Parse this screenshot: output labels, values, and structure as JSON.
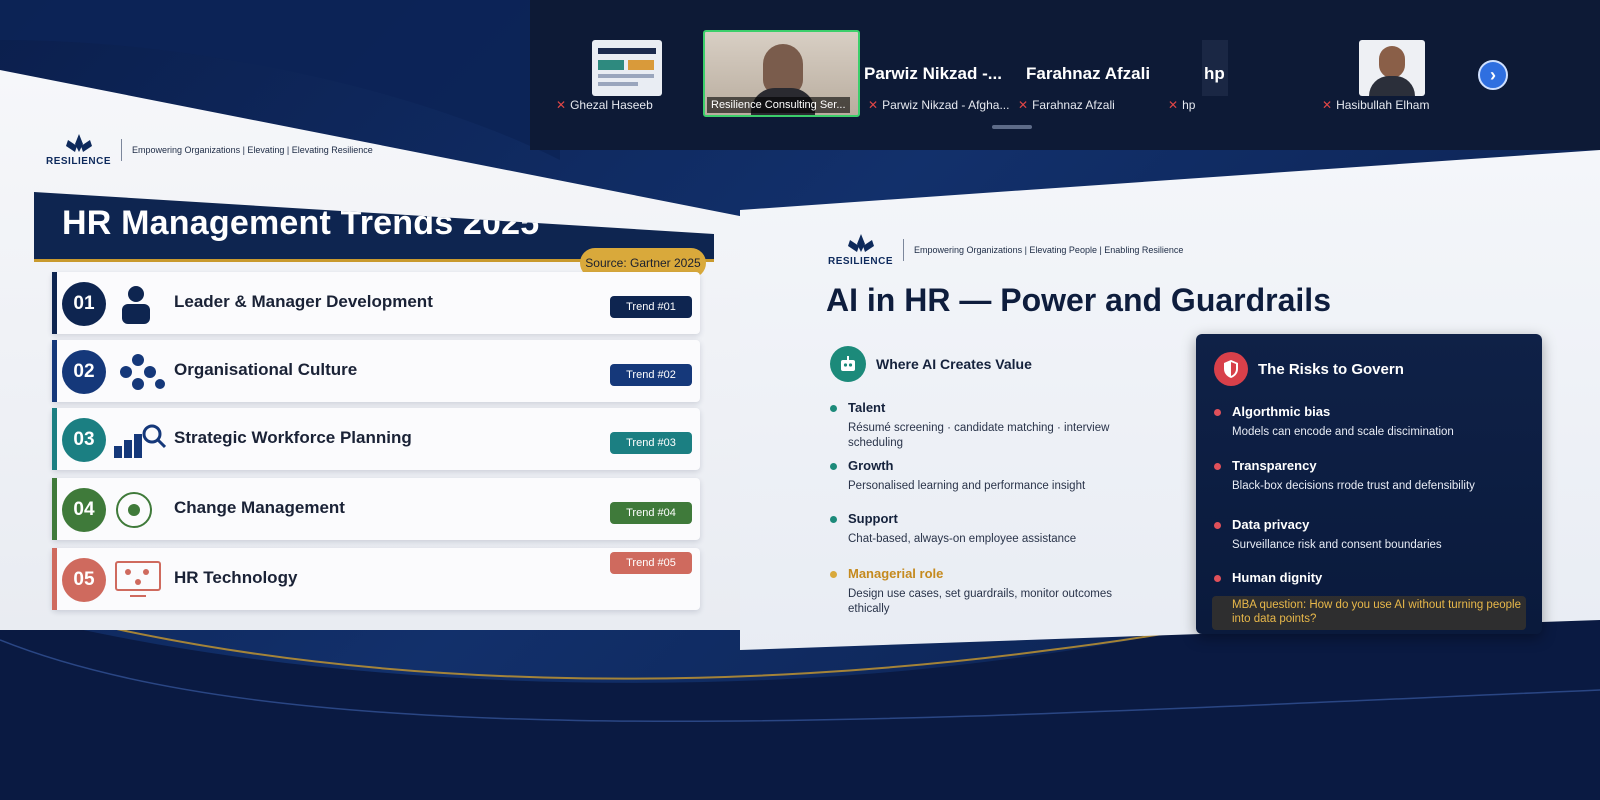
{
  "colors": {
    "navy": "#0e2550",
    "gold": "#d9a93b",
    "teal": "#1c8a7a",
    "risk_red": "#d8404a",
    "trend_colors": [
      "#0e2550",
      "#15387a",
      "#1b7f82",
      "#3f7a3a",
      "#cf6a5e"
    ]
  },
  "participants": [
    {
      "name": "Ghezal Haseeb",
      "muted": true,
      "thumb": "slide-thumbnail"
    },
    {
      "name": "Resilience Consulting Ser...",
      "muted": false,
      "thumb": "webcam",
      "active": true
    },
    {
      "name": "Parwiz Nikzad - Afgha...",
      "muted": true,
      "display": "Parwiz  Nikzad  -..."
    },
    {
      "name": "Farahnaz Afzali",
      "muted": true,
      "display": "Farahnaz Afzali"
    },
    {
      "name": "hp",
      "muted": true,
      "display": "hp"
    },
    {
      "name": "Hasibullah Elham",
      "muted": true,
      "thumb": "avatar-photo"
    }
  ],
  "left_slide": {
    "logo": {
      "word": "RESILIENCE",
      "tagline": "Empowering Organizations | Elevating | Elevating Resilience"
    },
    "title": "HR Management Trends 2025",
    "source": "Source: Gartner 2025",
    "trends": [
      {
        "num": "01",
        "label": "Leader & Manager Development",
        "tag": "Trend #01",
        "icon": "person-icon"
      },
      {
        "num": "02",
        "label": "Organisational Culture",
        "tag": "Trend #02",
        "icon": "network-dots-icon"
      },
      {
        "num": "03",
        "label": "Strategic Workforce Planning",
        "tag": "Trend #03",
        "icon": "chart-search-icon"
      },
      {
        "num": "04",
        "label": "Change Management",
        "tag": "Trend #04",
        "icon": "target-icon"
      },
      {
        "num": "05",
        "label": "HR Technology",
        "tag": "Trend #05",
        "icon": "monitor-icon"
      }
    ]
  },
  "right_slide": {
    "logo": {
      "word": "RESILIENCE",
      "tagline": "Empowering Organizations | Elevating People | Enabling Resilience"
    },
    "title": "AI in HR — Power and Guardrails",
    "value": {
      "heading": "Where AI Creates Value",
      "items": [
        {
          "title": "Talent",
          "desc": "Résumé screening · candidate matching · interview scheduling"
        },
        {
          "title": "Growth",
          "desc": "Personalised learning and performance insight"
        },
        {
          "title": "Support",
          "desc": "Chat-based, always-on employee assistance"
        },
        {
          "title": "Managerial role",
          "desc": "Design use cases, set guardrails, monitor outcomes ethically"
        }
      ]
    },
    "risks": {
      "heading": "The Risks to Govern",
      "items": [
        {
          "title": "Algorthmic bias",
          "desc": "Models can encode and scale discimination"
        },
        {
          "title": "Transparency",
          "desc": "Black-box decisions rrode trust and defensibility"
        },
        {
          "title": "Data privacy",
          "desc": "Surveillance risk and consent boundaries"
        },
        {
          "title": "Human dignity",
          "desc": ""
        }
      ],
      "question": "MBA question: How do you use AI without turning people into data points?"
    }
  }
}
